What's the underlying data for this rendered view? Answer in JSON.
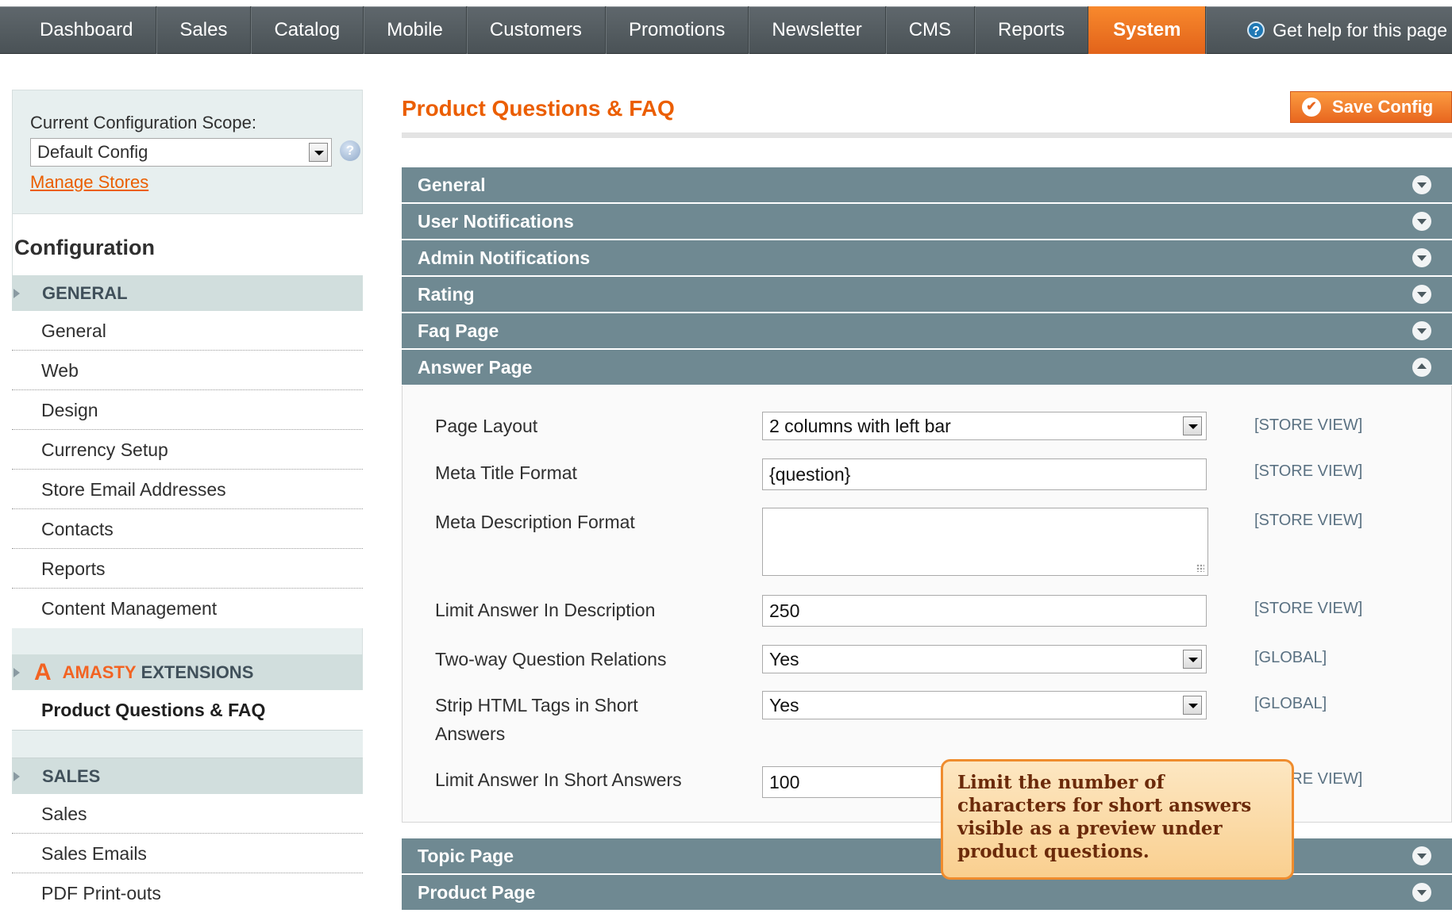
{
  "nav": {
    "items": [
      "Dashboard",
      "Sales",
      "Catalog",
      "Mobile",
      "Customers",
      "Promotions",
      "Newsletter",
      "CMS",
      "Reports",
      "System"
    ],
    "active": "System",
    "help_label": "Get help for this page"
  },
  "scope": {
    "label": "Current Configuration Scope:",
    "selected": "Default Config",
    "manage_link": "Manage Stores"
  },
  "sidebar": {
    "title": "Configuration",
    "general_header": "GENERAL",
    "general_items": [
      "General",
      "Web",
      "Design",
      "Currency Setup",
      "Store Email Addresses",
      "Contacts",
      "Reports",
      "Content Management"
    ],
    "amasty_word": "AMASTY",
    "amasty_ext": "EXTENSIONS",
    "amasty_active_item": "Product Questions & FAQ",
    "sales_header": "SALES",
    "sales_items": [
      "Sales",
      "Sales Emails",
      "PDF Print-outs"
    ]
  },
  "main": {
    "title": "Product Questions & FAQ",
    "save_label": "Save Config",
    "sections": [
      "General",
      "User Notifications",
      "Admin Notifications",
      "Rating",
      "Faq Page",
      "Answer Page",
      "Topic Page",
      "Product Page"
    ],
    "expanded_section": "Answer Page",
    "fields": {
      "page_layout": {
        "label": "Page Layout",
        "value": "2 columns with left bar",
        "scope": "[STORE VIEW]"
      },
      "meta_title": {
        "label": "Meta Title Format",
        "value": "{question}",
        "scope": "[STORE VIEW]"
      },
      "meta_description": {
        "label": "Meta Description Format",
        "value": "",
        "scope": "[STORE VIEW]"
      },
      "limit_description": {
        "label": "Limit Answer In Description",
        "value": "250",
        "scope": "[STORE VIEW]"
      },
      "two_way": {
        "label": "Two-way Question Relations",
        "value": "Yes",
        "scope": "[GLOBAL]"
      },
      "strip_html": {
        "label_line1": "Strip HTML Tags in Short",
        "label_line2": "Answers",
        "value": "Yes",
        "scope": "[GLOBAL]"
      },
      "limit_short": {
        "label": "Limit Answer In Short Answers",
        "value": "100",
        "scope": "[STORE VIEW]"
      }
    }
  },
  "callout": {
    "text": "Limit the number of characters for short answers visible as a preview under product questions."
  },
  "colors": {
    "accent": "#eb5e00",
    "bar": "#6f8992",
    "sidebar_bg": "#e7efef"
  }
}
